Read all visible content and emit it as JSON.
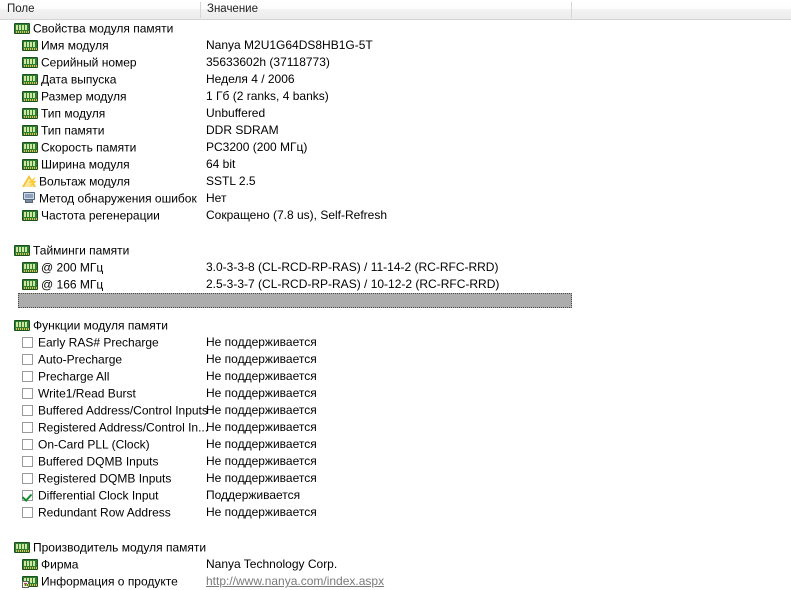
{
  "header": {
    "col_field": "Поле",
    "col_value": "Значение",
    "col_extra": ""
  },
  "sections": [
    {
      "id": "module-properties",
      "title": "Свойства модуля памяти",
      "icon": "ram-icon",
      "rows": [
        {
          "label": "Имя модуля",
          "value": "Nanya M2U1G64DS8HB1G-5T",
          "icon": "ram-icon"
        },
        {
          "label": "Серийный номер",
          "value": "35633602h (37118773)",
          "icon": "ram-icon"
        },
        {
          "label": "Дата выпуска",
          "value": "Неделя 4 / 2006",
          "icon": "ram-icon"
        },
        {
          "label": "Размер модуля",
          "value": "1 Гб (2 ranks, 4 banks)",
          "icon": "ram-icon"
        },
        {
          "label": "Тип модуля",
          "value": "Unbuffered",
          "icon": "ram-icon"
        },
        {
          "label": "Тип памяти",
          "value": "DDR SDRAM",
          "icon": "ram-icon"
        },
        {
          "label": "Скорость памяти",
          "value": "PC3200 (200 МГц)",
          "icon": "ram-icon"
        },
        {
          "label": "Ширина модуля",
          "value": "64 bit",
          "icon": "ram-icon"
        },
        {
          "label": "Вольтаж модуля",
          "value": "SSTL 2.5",
          "icon": "voltage-warning-icon"
        },
        {
          "label": "Метод обнаружения ошибок",
          "value": "Нет",
          "icon": "monitor-icon"
        },
        {
          "label": "Частота регенерации",
          "value": "Сокращено (7.8 us), Self-Refresh",
          "icon": "ram-icon"
        }
      ]
    },
    {
      "id": "memory-timings",
      "title": "Тайминги памяти",
      "icon": "ram-icon",
      "rows": [
        {
          "label": "@ 200 МГц",
          "value": "3.0-3-3-8  (CL-RCD-RP-RAS) / 11-14-2  (RC-RFC-RRD)",
          "icon": "ram-icon"
        },
        {
          "label": "@ 166 МГц",
          "value": "2.5-3-3-7  (CL-RCD-RP-RAS) / 10-12-2  (RC-RFC-RRD)",
          "icon": "ram-icon"
        }
      ]
    },
    {
      "id": "module-features",
      "title": "Функции модуля памяти",
      "icon": "ram-icon",
      "rows": [
        {
          "label": "Early RAS# Precharge",
          "value": "Не поддерживается",
          "checked": false
        },
        {
          "label": "Auto-Precharge",
          "value": "Не поддерживается",
          "checked": false
        },
        {
          "label": "Precharge All",
          "value": "Не поддерживается",
          "checked": false
        },
        {
          "label": "Write1/Read Burst",
          "value": "Не поддерживается",
          "checked": false
        },
        {
          "label": "Buffered Address/Control Inputs",
          "value": "Не поддерживается",
          "checked": false
        },
        {
          "label": "Registered Address/Control In...",
          "value": "Не поддерживается",
          "checked": false
        },
        {
          "label": "On-Card PLL (Clock)",
          "value": "Не поддерживается",
          "checked": false
        },
        {
          "label": "Buffered DQMB Inputs",
          "value": "Не поддерживается",
          "checked": false
        },
        {
          "label": "Registered DQMB Inputs",
          "value": "Не поддерживается",
          "checked": false
        },
        {
          "label": "Differential Clock Input",
          "value": "Поддерживается",
          "checked": true
        },
        {
          "label": "Redundant Row Address",
          "value": "Не поддерживается",
          "checked": false
        }
      ]
    },
    {
      "id": "module-manufacturer",
      "title": "Производитель модуля памяти",
      "icon": "ram-icon",
      "rows": [
        {
          "label": "Фирма",
          "value": "Nanya Technology Corp.",
          "icon": "ram-icon"
        },
        {
          "label": "Информация о продукте",
          "value": "http://www.nanya.com/index.aspx",
          "icon": "ram-product-info-icon",
          "link": true
        }
      ]
    }
  ],
  "selection": {
    "visible": true
  },
  "colors": {
    "accent_green": "#2f7d32",
    "check_green": "#138c2e",
    "selection_gray": "#acacac",
    "link_gray": "#7a7a7a",
    "header_border": "#d4d4d4"
  }
}
